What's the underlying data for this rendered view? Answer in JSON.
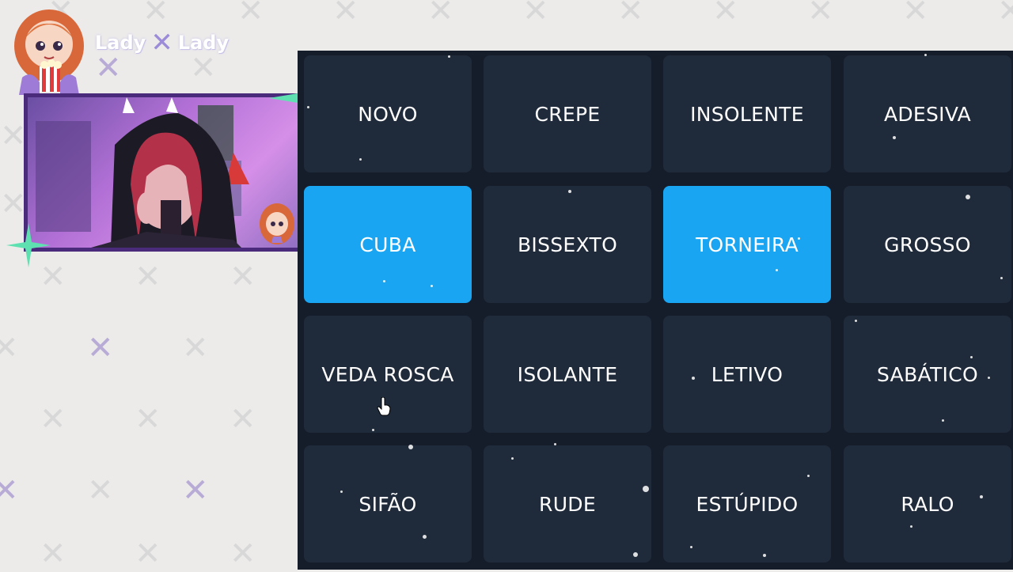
{
  "brand": {
    "left": "Lady",
    "right": "Lady"
  },
  "board": {
    "words": [
      {
        "label": "NOVO",
        "selected": false
      },
      {
        "label": "CREPE",
        "selected": false
      },
      {
        "label": "INSOLENTE",
        "selected": false
      },
      {
        "label": "ADESIVA",
        "selected": false
      },
      {
        "label": "CUBA",
        "selected": true
      },
      {
        "label": "BISSEXTO",
        "selected": false
      },
      {
        "label": "TORNEIRA",
        "selected": true
      },
      {
        "label": "GROSSO",
        "selected": false
      },
      {
        "label": "VEDA ROSCA",
        "selected": false
      },
      {
        "label": "ISOLANTE",
        "selected": false
      },
      {
        "label": "LETIVO",
        "selected": false
      },
      {
        "label": "SABÁTICO",
        "selected": false
      },
      {
        "label": "SIFÃO",
        "selected": false
      },
      {
        "label": "RUDE",
        "selected": false
      },
      {
        "label": "ESTÚPIDO",
        "selected": false
      },
      {
        "label": "RALO",
        "selected": false
      }
    ]
  },
  "colors": {
    "board_bg": "#151d2b",
    "tile_bg": "#1f2a3a",
    "tile_selected": "#1aa5f2",
    "webcam_frame": "#4a2a7a",
    "sparkle": "#5fe0b0"
  },
  "icons": {
    "mascot": "popcorn-girl-avatar",
    "logo_x": "x-logo-icon",
    "sparkle": "star-sparkle-icon",
    "cursor": "hand-pointer-cursor-icon"
  }
}
